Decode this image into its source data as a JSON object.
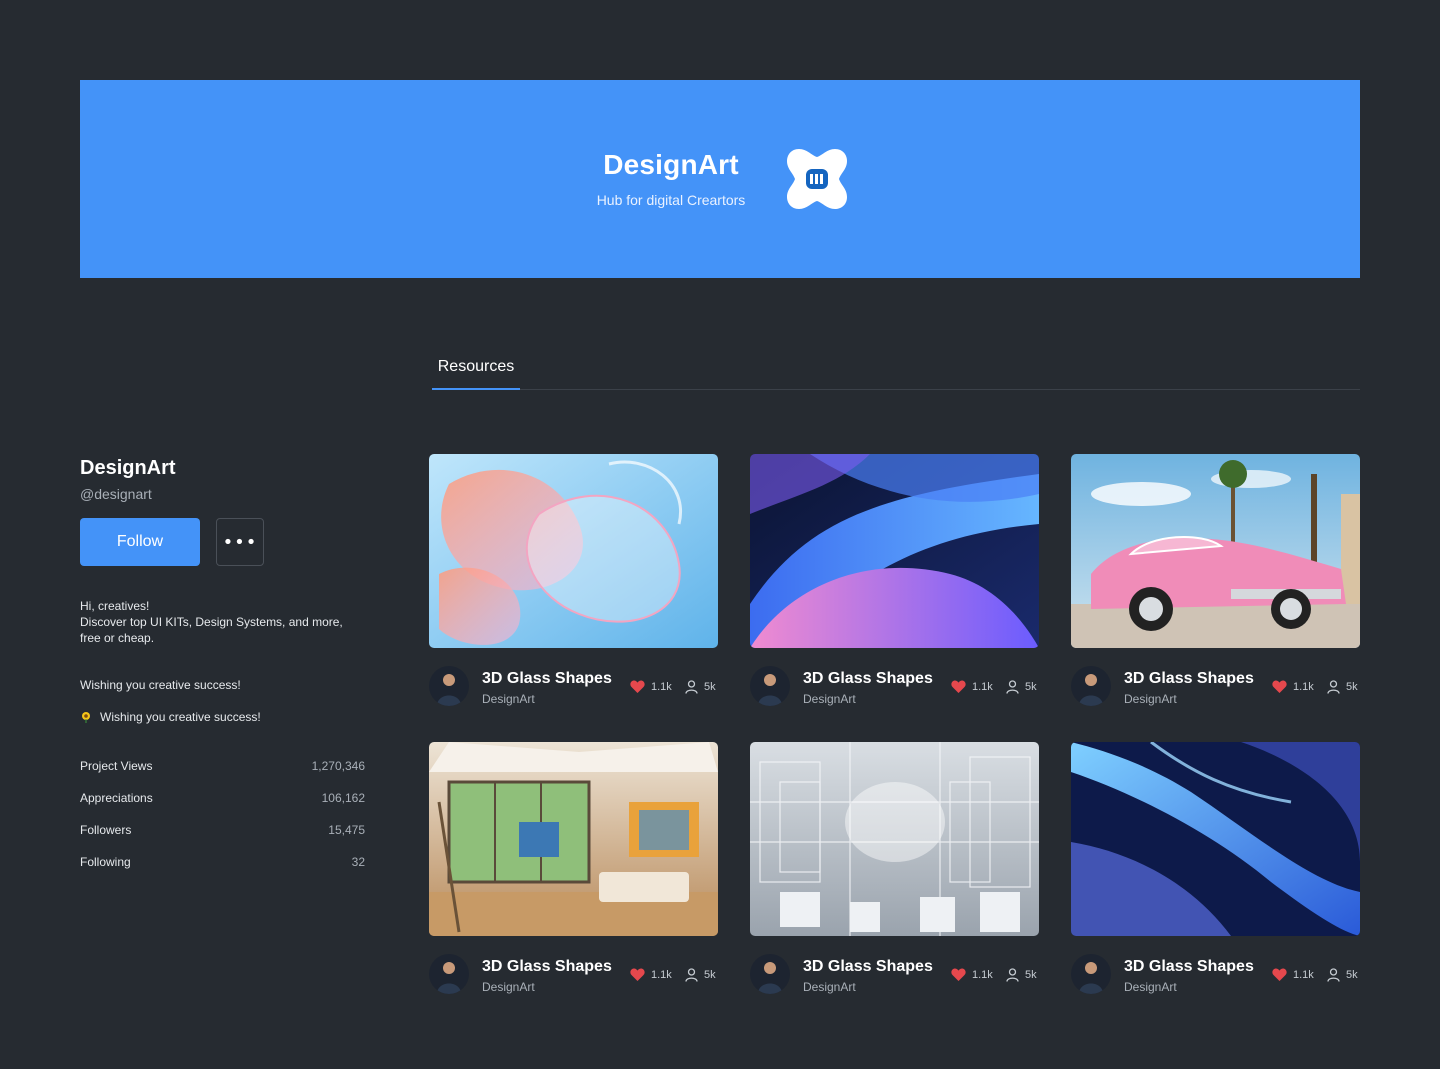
{
  "banner": {
    "title": "DesignArt",
    "subtitle": "Hub for digital Creartors",
    "logo_icon": "puzzle-logo-icon",
    "background": "#4493f8"
  },
  "tabs": [
    {
      "label": "Resources",
      "active": true
    }
  ],
  "profile": {
    "name": "DesignArt",
    "handle": "@designart",
    "follow_label": "Follow",
    "more_label": "•••",
    "bio": [
      "Hi, creatives!",
      "Discover top UI KITs, Design Systems, and more,",
      "free or cheap."
    ],
    "wish": "Wishing you creative success!",
    "wish_emoji_text": "Wishing you creative success!",
    "stats": [
      {
        "label": "Project Views",
        "value": "1,270,346"
      },
      {
        "label": "Appreciations",
        "value": "106,162"
      },
      {
        "label": "Followers",
        "value": "15,475"
      },
      {
        "label": "Following",
        "value": "32"
      }
    ]
  },
  "cards": [
    {
      "title": "3D Glass Shapes",
      "author": "DesignArt",
      "likes": "1.1k",
      "views": "5k",
      "image": "glass-shapes"
    },
    {
      "title": "3D Glass Shapes",
      "author": "DesignArt",
      "likes": "1.1k",
      "views": "5k",
      "image": "blue-waves"
    },
    {
      "title": "3D Glass Shapes",
      "author": "DesignArt",
      "likes": "1.1k",
      "views": "5k",
      "image": "pink-car"
    },
    {
      "title": "3D Glass Shapes",
      "author": "DesignArt",
      "likes": "1.1k",
      "views": "5k",
      "image": "art-studio"
    },
    {
      "title": "3D Glass Shapes",
      "author": "DesignArt",
      "likes": "1.1k",
      "views": "5k",
      "image": "white-city"
    },
    {
      "title": "3D Glass Shapes",
      "author": "DesignArt",
      "likes": "1.1k",
      "views": "5k",
      "image": "blue-ribbon"
    }
  ],
  "colors": {
    "background": "#262b31",
    "accent": "#4493f8",
    "heart": "#e5484d"
  }
}
